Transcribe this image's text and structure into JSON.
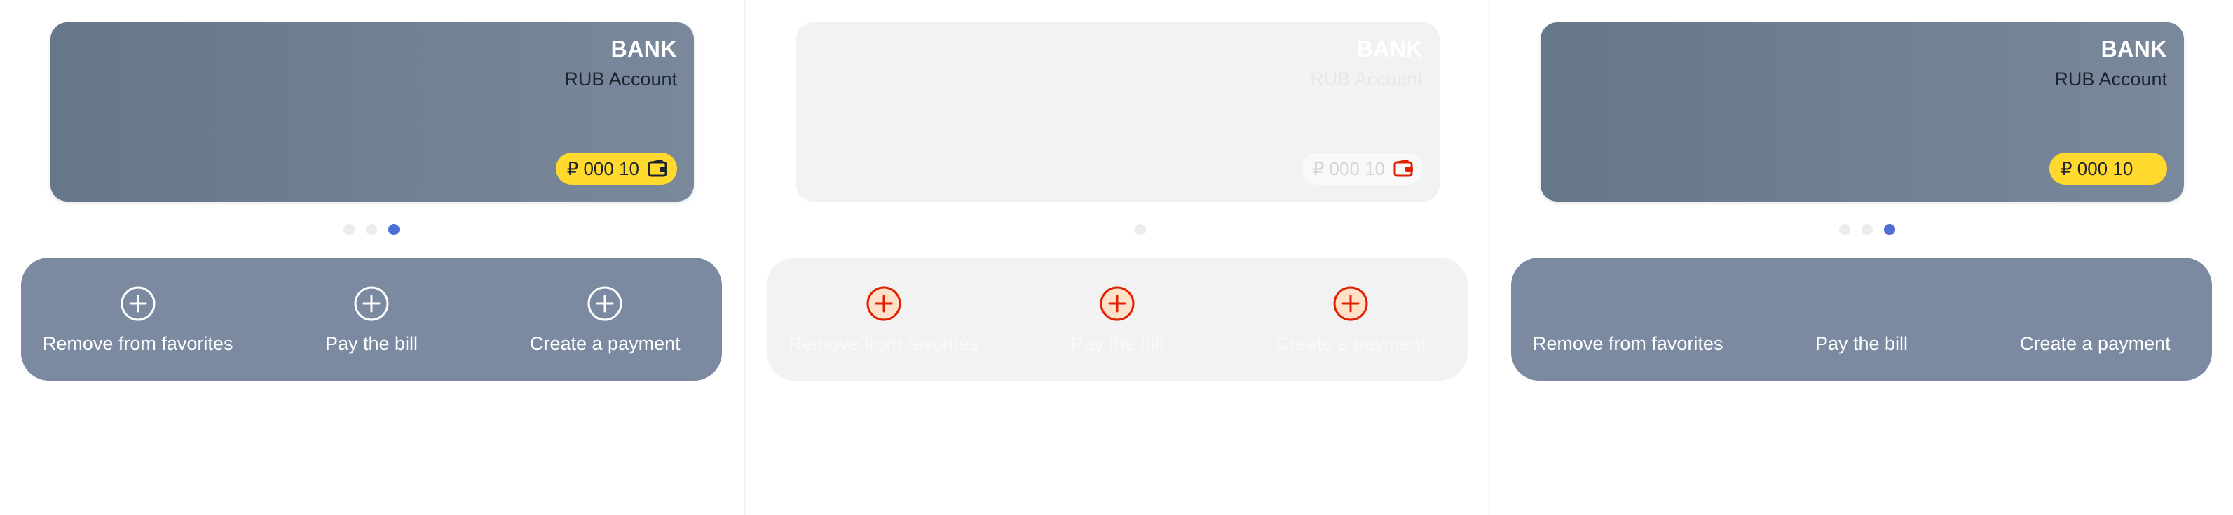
{
  "colors": {
    "card_gradient_start": "#667789",
    "card_gradient_end": "#7a889b",
    "actions_bg": "#7b8aa0",
    "ghost_bg": "#f2f2f3",
    "balance_pill": "#ffd92e",
    "dot_active": "#4d6fd3",
    "dot_inactive": "#ececee",
    "ghost_icon": "#e02000"
  },
  "panels": [
    {
      "card": {
        "title": "BANK",
        "subtitle": "RUB Account",
        "balance": "₽ 000 10",
        "balance_icon": "wallet-icon"
      },
      "pagination": {
        "count": 3,
        "active": 3
      },
      "actions": [
        {
          "label": "Remove from favorites",
          "icon": "plus-circle-icon"
        },
        {
          "label": "Pay the bill",
          "icon": "plus-circle-icon"
        },
        {
          "label": "Create a payment",
          "icon": "plus-circle-icon"
        }
      ]
    },
    {
      "card": {
        "title": "BANK",
        "subtitle": "RUB Account",
        "balance": "₽ 000 10",
        "balance_icon": "wallet-icon"
      },
      "pagination": {
        "count": 1,
        "active": 0
      },
      "actions": [
        {
          "label": "Remove from favorites",
          "icon": "plus-circle-icon"
        },
        {
          "label": "Pay the bill",
          "icon": "plus-circle-icon"
        },
        {
          "label": "Create a payment",
          "icon": "plus-circle-icon"
        }
      ]
    },
    {
      "card": {
        "title": "BANK",
        "subtitle": "RUB Account",
        "balance": "₽ 000 10"
      },
      "pagination": {
        "count": 3,
        "active": 3
      },
      "actions": [
        {
          "label": "Remove from favorites"
        },
        {
          "label": "Pay the bill"
        },
        {
          "label": "Create a payment"
        }
      ]
    }
  ]
}
